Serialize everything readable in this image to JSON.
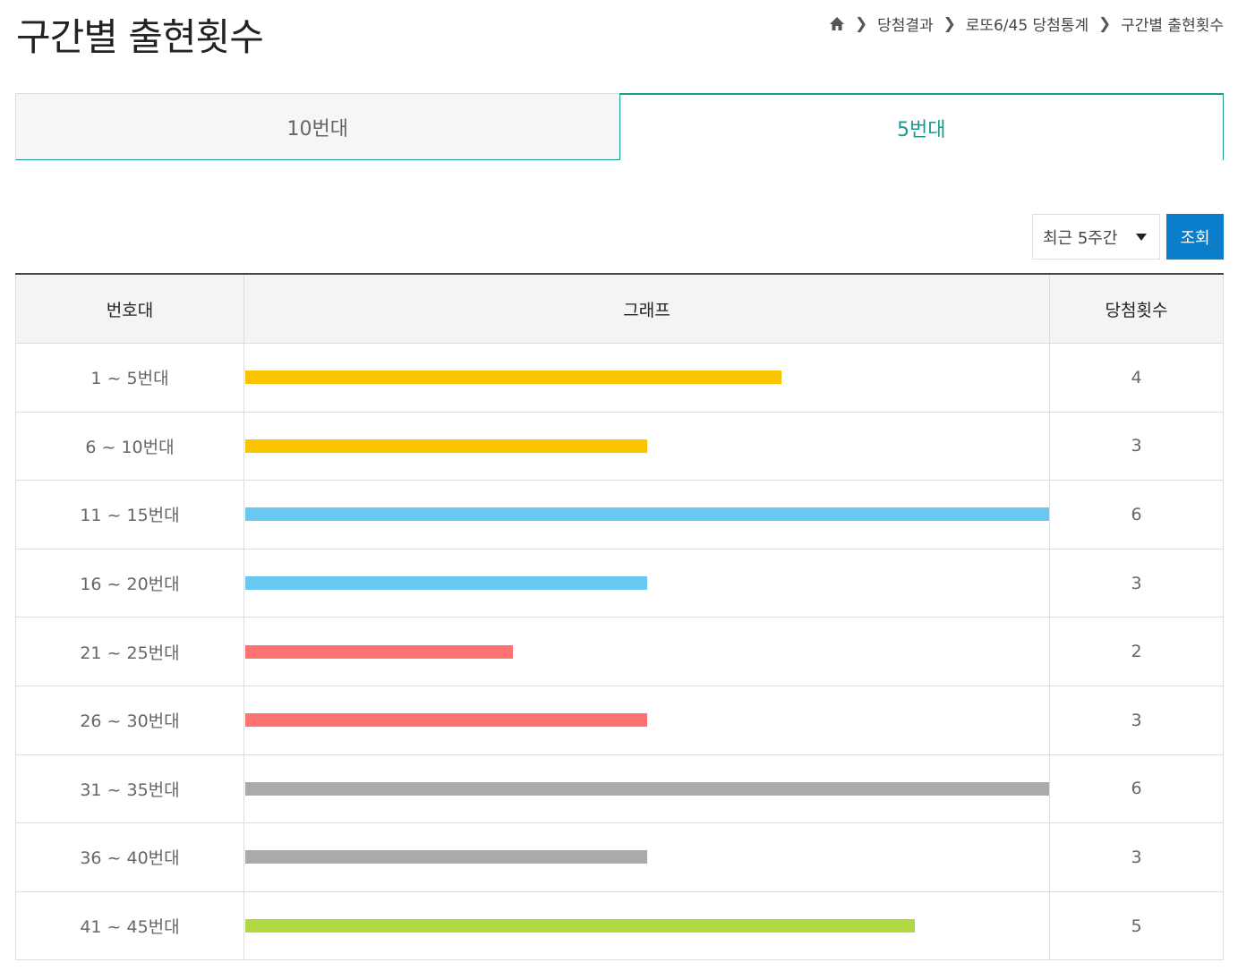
{
  "page": {
    "title": "구간별 출현횟수",
    "breadcrumb": [
      "당첨결과",
      "로또6/45 당첨통계",
      "구간별 출현횟수"
    ]
  },
  "tabs": [
    {
      "label": "10번대",
      "active": false
    },
    {
      "label": "5번대",
      "active": true
    }
  ],
  "filter": {
    "selected": "최근 5주간",
    "button_label": "조회"
  },
  "table": {
    "headers": [
      "번호대",
      "그래프",
      "당첨횟수"
    ],
    "max_count": 6
  },
  "chart_data": {
    "type": "bar",
    "orientation": "horizontal",
    "categories": [
      "1 ~ 5번대",
      "6 ~ 10번대",
      "11 ~ 15번대",
      "16 ~ 20번대",
      "21 ~ 25번대",
      "26 ~ 30번대",
      "31 ~ 35번대",
      "36 ~ 40번대",
      "41 ~ 45번대"
    ],
    "values": [
      4,
      3,
      6,
      3,
      2,
      3,
      6,
      3,
      5
    ],
    "colors": [
      "#fbc400",
      "#fbc400",
      "#69c8f2",
      "#69c8f2",
      "#ff7272",
      "#ff7272",
      "#aaaaaa",
      "#aaaaaa",
      "#b0d840"
    ],
    "xlim": [
      0,
      6
    ]
  }
}
